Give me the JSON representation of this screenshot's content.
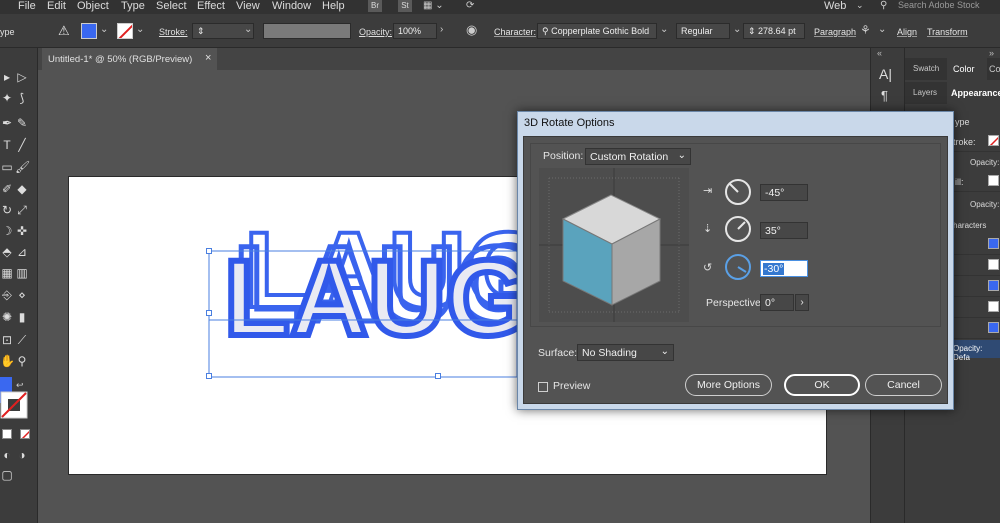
{
  "menubar": {
    "items": [
      "File",
      "Edit",
      "Object",
      "Type",
      "Select",
      "Effect",
      "View",
      "Window",
      "Help"
    ],
    "br_label": "Br",
    "st_label": "St",
    "workspace": "Web",
    "search_placeholder": "Search Adobe Stock"
  },
  "controlbar": {
    "type_label": "ype",
    "stroke_label": "Stroke:",
    "opacity_label": "Opacity:",
    "opacity_value": "100%",
    "character_label": "Character:",
    "font_family": "Copperplate Gothic Bold",
    "font_style": "Regular",
    "font_size": "278.64 pt",
    "paragraph_label": "Paragraph",
    "align_label": "Align",
    "transform_label": "Transform",
    "fill_color": "#3a68f0"
  },
  "document": {
    "tab_title": "Untitled-1* @ 50% (RGB/Preview)",
    "close_glyph": "×",
    "artwork_text": "LAUGH",
    "text_color": "#3158e8"
  },
  "right_panel": {
    "tabs_top": [
      "Swatch",
      "Color",
      "Colo"
    ],
    "tabs_mid": [
      "Layers",
      "Appearance"
    ],
    "type_label": "ype",
    "stroke_label": "troke:",
    "opacity_label": "Opacity:",
    "fill_label": "ill:",
    "characters_label": "haracters",
    "opacity_default": "Opacity: Defa"
  },
  "dialog": {
    "title": "3D Rotate Options",
    "position_label": "Position:",
    "position_value": "Custom Rotation",
    "x_rotation": "-45°",
    "y_rotation": "35°",
    "z_rotation": "-30°",
    "perspective_label": "Perspective:",
    "perspective_value": "0°",
    "surface_label": "Surface:",
    "surface_value": "No Shading",
    "preview_label": "Preview",
    "more_options_label": "More Options",
    "ok_label": "OK",
    "cancel_label": "Cancel",
    "cube_front_color": "#5aa3bd",
    "cube_top_color": "#d8d8d8",
    "cube_side_color": "#a7a7a7"
  }
}
